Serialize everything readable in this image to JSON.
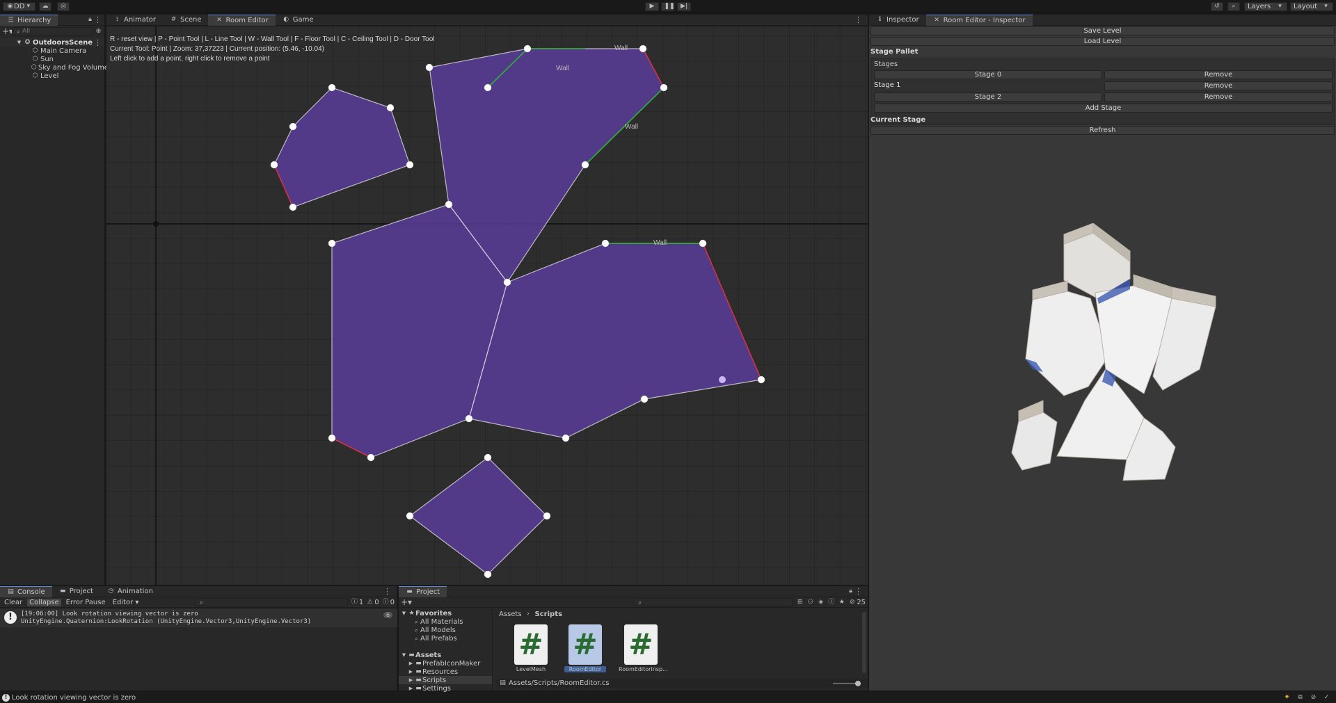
{
  "toolbar": {
    "account": "DD",
    "layers": "Layers",
    "layout": "Layout"
  },
  "hierarchy": {
    "tab": "Hierarchy",
    "search_placeholder": "All",
    "scene": "OutdoorsScene",
    "items": [
      "Main Camera",
      "Sun",
      "Sky and Fog Volume",
      "Level"
    ]
  },
  "center_tabs": [
    "Animator",
    "Scene",
    "Room Editor",
    "Game"
  ],
  "room_editor": {
    "help_line": "R - reset view | P - Point Tool | L - Line Tool | W - Wall Tool | F - Floor Tool | C - Ceiling Tool | D - Door Tool",
    "status_line": "Current Tool: Point | Zoom: 37,37223 | Current position: (5.46, -10.04)",
    "hint_line": "Left click to add a point, right click to remove a point",
    "wall_label": "Wall"
  },
  "inspector": {
    "tabs": [
      "Inspector",
      "Room Editor - Inspector"
    ],
    "save_level": "Save Level",
    "load_level": "Load Level",
    "stage_pallet": "Stage Pallet",
    "stages_label": "Stages",
    "stages": [
      {
        "name": "Stage 0",
        "style": "button"
      },
      {
        "name": "Stage 1",
        "style": "label"
      },
      {
        "name": "Stage 2",
        "style": "button"
      }
    ],
    "remove": "Remove",
    "add_stage": "Add Stage",
    "current_stage": "Current Stage",
    "refresh": "Refresh"
  },
  "console": {
    "tabs": [
      "Console",
      "Project",
      "Animation"
    ],
    "clear": "Clear",
    "collapse": "Collapse",
    "error_pause": "Error Pause",
    "editor": "Editor",
    "counts": {
      "info": "1",
      "warn": "0",
      "error": "0"
    },
    "message_line1": "[19:06:00] Look rotation viewing vector is zero",
    "message_line2": "UnityEngine.Quaternion:LookRotation (UnityEngine.Vector3,UnityEngine.Vector3)",
    "message_count": "6"
  },
  "project": {
    "tab": "Project",
    "favorites": "Favorites",
    "favorite_items": [
      "All Materials",
      "All Models",
      "All Prefabs"
    ],
    "assets": "Assets",
    "asset_folders": [
      "PrefabIconMaker",
      "Resources",
      "Scripts",
      "Settings"
    ],
    "breadcrumb": [
      "Assets",
      "Scripts"
    ],
    "files": [
      "LevelMesh",
      "RoomEditor",
      "RoomEditorInsp..."
    ],
    "path": "Assets/Scripts/RoomEditor.cs",
    "hidden_count": "25"
  },
  "statusbar": {
    "message": "Look rotation viewing vector is zero"
  },
  "colors": {
    "accent": "#5a8ad8",
    "polygon_fill": "#5b3d9e",
    "wall_green": "#2fae3a",
    "edge_red": "#d03040"
  }
}
